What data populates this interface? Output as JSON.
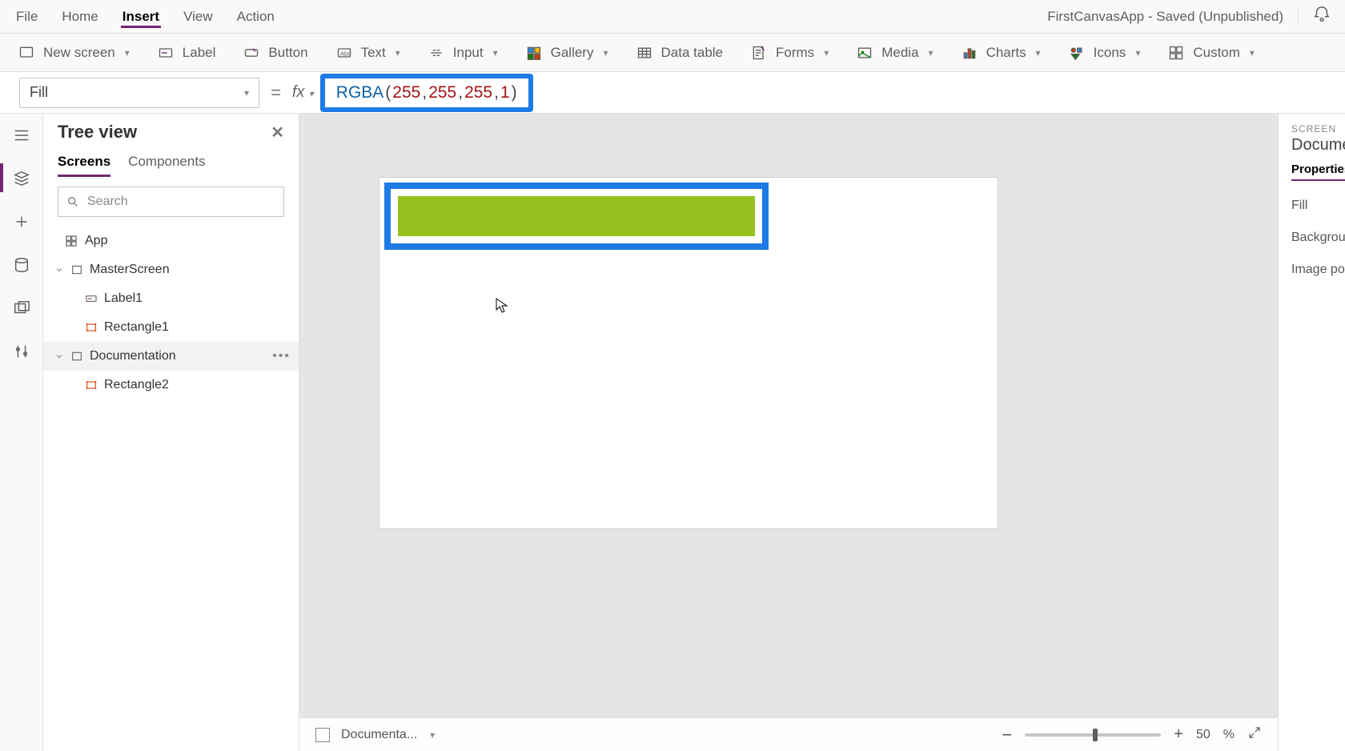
{
  "menubar": {
    "items": [
      "File",
      "Home",
      "Insert",
      "View",
      "Action"
    ],
    "active_index": 2,
    "doc_status": "FirstCanvasApp - Saved (Unpublished)"
  },
  "ribbon": {
    "new_screen": "New screen",
    "label": "Label",
    "button": "Button",
    "text": "Text",
    "input": "Input",
    "gallery": "Gallery",
    "data_table": "Data table",
    "forms": "Forms",
    "media": "Media",
    "charts": "Charts",
    "icons": "Icons",
    "custom": "Custom"
  },
  "formula": {
    "property": "Fill",
    "eq": "=",
    "fx": "fx",
    "tokens": {
      "fn": "RGBA",
      "open": "(",
      "n1": "255",
      "sep": ", ",
      "n2": "255",
      "n3": "255",
      "n4": "1",
      "close": ")"
    }
  },
  "tree": {
    "title": "Tree view",
    "tabs": {
      "screens": "Screens",
      "components": "Components"
    },
    "search_placeholder": "Search",
    "app": "App",
    "items": [
      {
        "name": "MasterScreen",
        "type": "screen"
      },
      {
        "name": "Label1",
        "type": "label"
      },
      {
        "name": "Rectangle1",
        "type": "rect"
      },
      {
        "name": "Documentation",
        "type": "screen",
        "selected": true
      },
      {
        "name": "Rectangle2",
        "type": "rect"
      }
    ]
  },
  "canvas": {
    "breadcrumb": "Documenta...",
    "zoom": {
      "label": "50",
      "pct": "%",
      "position": 50
    }
  },
  "props": {
    "kicker": "SCREEN",
    "title": "Documentation",
    "tab": "Properties",
    "rows": [
      "Fill",
      "Background image",
      "Image position"
    ]
  }
}
